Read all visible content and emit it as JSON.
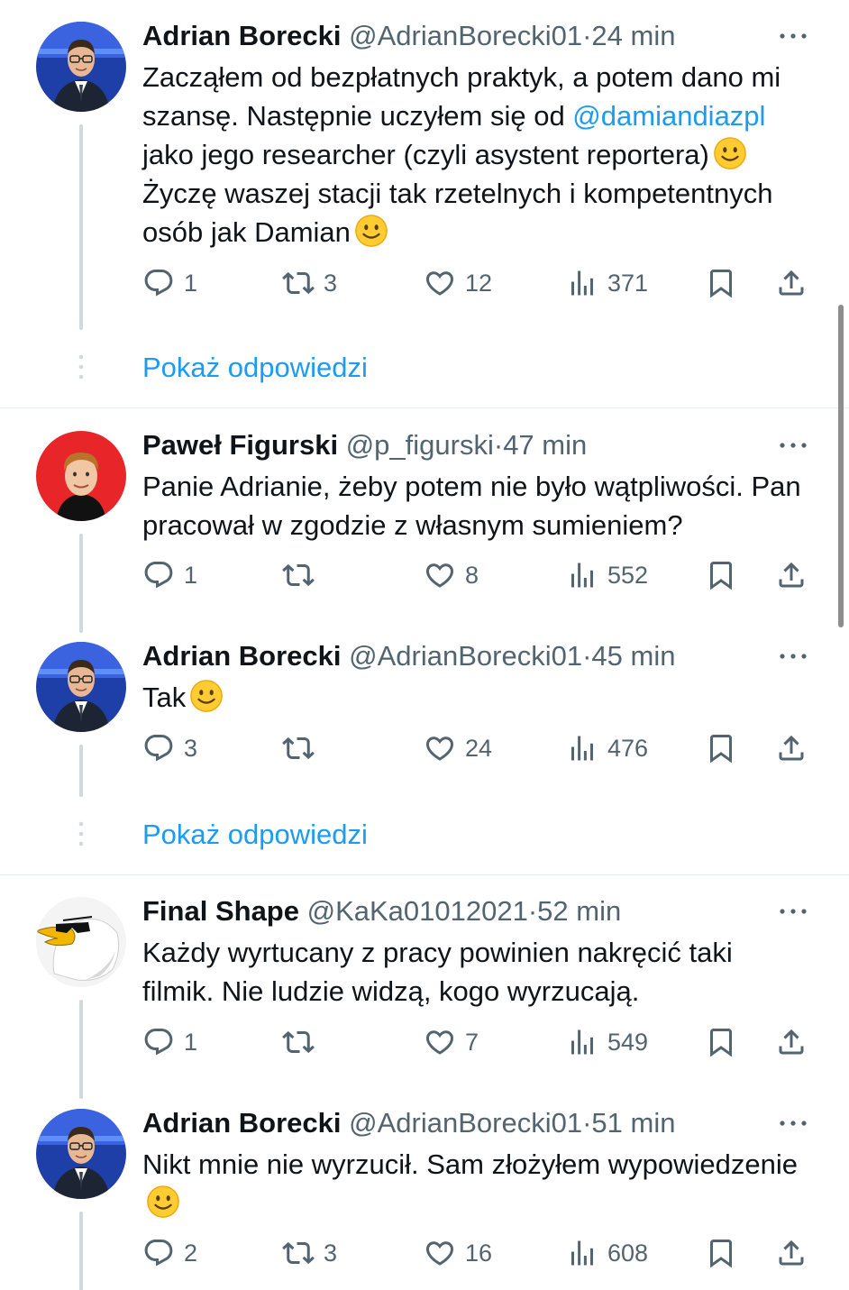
{
  "colors": {
    "accent": "#1d9bf0",
    "secondary_text": "#536471",
    "thread_line": "#cfd9de"
  },
  "show_replies_label": "Pokaż odpowiedzi",
  "tweets": [
    {
      "name": "Adrian Borecki",
      "handle": "@AdrianBorecki01",
      "dot": "·",
      "time": "24 min",
      "text": {
        "part1": "Zacząłem od bezpłatnych praktyk, a potem dano mi szansę. Następnie uczyłem się od ",
        "mention": "@damiandiazpl",
        "part2": "  jako jego researcher (czyli asystent reportera)",
        "part3": " Życzę waszej stacji tak rzetelnych i kompetentnych osób jak Damian"
      },
      "replies": "1",
      "retweets": "3",
      "likes": "12",
      "views": "371"
    },
    {
      "name": "Paweł Figurski",
      "handle": "@p_figurski",
      "dot": "·",
      "time": "47 min",
      "text": "Panie Adrianie, żeby potem nie było wątpliwości. Pan pracował w zgodzie z własnym sumieniem?",
      "replies": "1",
      "retweets": "",
      "likes": "8",
      "views": "552"
    },
    {
      "name": "Adrian Borecki",
      "handle": "@AdrianBorecki01",
      "dot": "·",
      "time": "45 min",
      "text": "Tak",
      "replies": "3",
      "retweets": "",
      "likes": "24",
      "views": "476"
    },
    {
      "name": "Final Shape",
      "handle": "@KaKa01012021",
      "dot": "·",
      "time": "52 min",
      "text": "Każdy wyrtucany z pracy powinien nakręcić taki filmik. Nie ludzie widzą, kogo wyrzucają.",
      "replies": "1",
      "retweets": "",
      "likes": "7",
      "views": "549"
    },
    {
      "name": "Adrian Borecki",
      "handle": "@AdrianBorecki01",
      "dot": "·",
      "time": "51 min",
      "text": "Nikt mnie nie wyrzucił. Sam złożyłem wypowiedzenie",
      "replies": "2",
      "retweets": "3",
      "likes": "16",
      "views": "608"
    }
  ]
}
